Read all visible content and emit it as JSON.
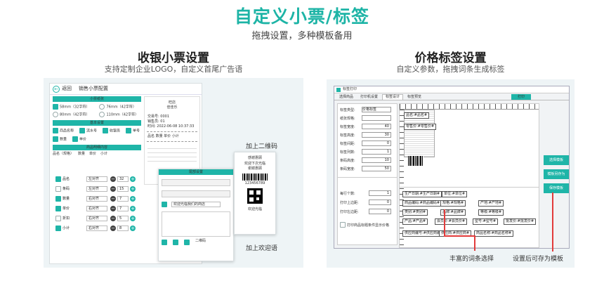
{
  "header": {
    "title": "自定义小票/标签",
    "subtitle": "拖拽设置，多种模板备用"
  },
  "left": {
    "title": "收银小票设置",
    "subtitle": "支持定制企业LOGO，自定义首尾广告语",
    "note_qr": "加上二维码",
    "note_welcome": "加上欢迎语",
    "app": {
      "back": "返回",
      "title": "销售小票配置",
      "section_paper": "小票纸张",
      "paper": [
        "58mm（32字符）",
        "76mm（42字符）",
        "80mm（42字符）",
        "110mm（42字符）"
      ],
      "section_header": "基本设置",
      "header_items": [
        "商品名称",
        "流水号",
        "收银员",
        "单号",
        "数量",
        "单价"
      ],
      "section_body": "商品明细内容",
      "body_header": [
        "品名（规格）",
        "数量",
        "单价",
        "小计"
      ],
      "rows": [
        {
          "name": "品名",
          "align": "左对齐",
          "val": "32"
        },
        {
          "name": "条码",
          "align": "左对齐",
          "val": "15"
        },
        {
          "name": "数量",
          "align": "右对齐",
          "val": "7"
        },
        {
          "name": "单价",
          "align": "右对齐",
          "val": "7"
        },
        {
          "name": "折扣",
          "align": "右对齐",
          "val": "5"
        },
        {
          "name": "小计",
          "align": "右对齐",
          "val": "8"
        }
      ],
      "preview": {
        "shop": "旺店",
        "sub": "佳佳乐",
        "lines": [
          "交易号: 0001",
          "销售员: 01",
          "时间: 2022-06-08 10:37:33",
          "品名   数量   单价   小计"
        ]
      },
      "footer_title": "尾部设置",
      "footer_text": "欢迎光临我们的商店",
      "tag_qr": "二维码"
    },
    "receipt2": {
      "title": "感谢惠顾",
      "lines": [
        "欢迎下次光临",
        "谢谢惠顾"
      ],
      "barcode": "123456789",
      "tail": "欢迎光临"
    }
  },
  "right": {
    "title": "价格标签设置",
    "subtitle": "自定义参数，拖拽词条生成标签",
    "note_words": "丰富的词条选择",
    "note_save": "设置后可存为模板",
    "app": {
      "title": "标签打印",
      "tabs": [
        "选择商品",
        "打印机设置",
        "标签设计",
        "标签预览"
      ],
      "print_btn": "打印",
      "form": [
        {
          "k": "标签类型:",
          "v": "价格标签"
        },
        {
          "k": "纸张规格:",
          "v": ""
        },
        {
          "k": "标签宽度:",
          "v": "40"
        },
        {
          "k": "标签高度:",
          "v": "30"
        },
        {
          "k": "标签间距:",
          "v": "0"
        },
        {
          "k": "标签列数:",
          "v": "1"
        },
        {
          "k": "条码高度:",
          "v": "10"
        },
        {
          "k": "条码宽度:",
          "v": "50"
        }
      ],
      "form2": [
        {
          "k": "每行个数:",
          "v": "1"
        },
        {
          "k": "打印上边距:",
          "v": "0"
        },
        {
          "k": "打印左边距:",
          "v": "0"
        }
      ],
      "checkbox": "打印商品标题条件显示价格",
      "canvas_labels": [
        "品名:#品名#",
        "零售价:#零售价#"
      ],
      "word_rows": [
        [
          "生产日期:#生产日期#",
          "单位:#单位#"
        ],
        [
          "商品编码:#商品编码#",
          "规格:#规格#",
          "产地:#产地#"
        ],
        [
          "类别:#类别#",
          "品牌:#品牌#",
          "等级:#等级#"
        ],
        [
          "产品:#产品#",
          "会员价:#会员价#",
          "型号:#型号#",
          "批发价:#批发价#"
        ],
        [
          "供应商编号:#供应商编号#",
          "供应商:#供应商#",
          "商品名称:#商品名称#"
        ]
      ],
      "buttons": [
        "选择模板",
        "模板另存为",
        "保存模板"
      ]
    }
  }
}
